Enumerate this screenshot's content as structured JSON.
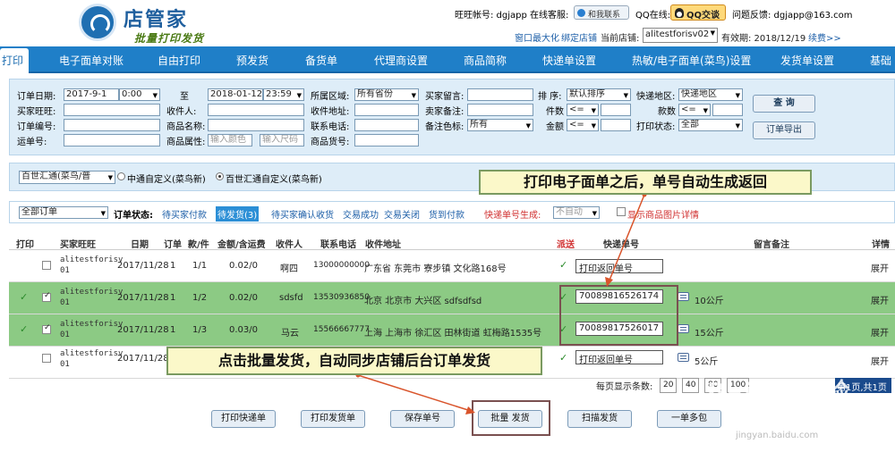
{
  "header": {
    "logo_title": "店管家",
    "logo_subtitle": "批量打印发货",
    "wangwang_label": "旺旺帐号: dgjapp 在线客服:",
    "cs_button": "和我联系",
    "qq_label": "QQ在线:",
    "qq_button": "QQ交谈",
    "feedback": "问题反馈: dgjapp@163.com",
    "window_max": "窗口最大化",
    "bind_shop": "绑定店铺",
    "current_shop_label": "当前店铺:",
    "current_shop": "alitestforisv02",
    "valid_until": "有效期: 2018/12/19",
    "renew": "续费>>"
  },
  "nav": {
    "tabs": [
      "打印",
      "电子面单对账",
      "自由打印",
      "预发货",
      "备货单",
      "代理商设置",
      "商品简称",
      "快递单设置",
      "热敏/电子面单(菜鸟)设置",
      "发货单设置",
      "基础"
    ]
  },
  "filter": {
    "order_date_label": "订单日期:",
    "date_from": "2017-9-1",
    "time_from": "0:00",
    "to_label": "至",
    "date_to": "2018-01-12",
    "time_to": "23:59",
    "region_label": "所属区域:",
    "region_value": "所有省份",
    "buyer_msg_label": "买家留言:",
    "sort_label": "排 序:",
    "sort_value": "默认排序",
    "express_region_label": "快递地区:",
    "express_region_value": "快递地区",
    "buyer_ww_label": "买家旺旺:",
    "receiver_label": "收件人:",
    "address_label": "收件地址:",
    "seller_note_label": "卖家备注:",
    "item_count_label": "件数",
    "item_count_op": "<=",
    "kinds_label": "款数",
    "kinds_op": "<=",
    "order_no_label": "订单编号:",
    "goods_name_label": "商品名称:",
    "phone_label": "联系电话:",
    "note_color_label": "备注色标:",
    "note_color_value": "所有",
    "amount_label": "金额",
    "amount_op": "<=",
    "print_status_label": "打印状态:",
    "print_status_value": "全部",
    "waybill_label": "运单号:",
    "goods_attr_label": "商品属性:",
    "color_placeholder": "输入颜色",
    "size_placeholder": "输入尺码",
    "goods_code_label": "商品货号:",
    "query_button": "查 询",
    "export_button": "订单导出"
  },
  "template_bar": {
    "select_value": "百世汇通(菜鸟/普",
    "radio1": "中通自定义(菜鸟新)",
    "radio2": "百世汇通自定义(菜鸟新)"
  },
  "status_bar": {
    "order_filter": "全部订单",
    "status_label": "订单状态:",
    "statuses": [
      "待买家付款",
      "待发货",
      "待买家确认收货",
      "交易成功",
      "交易关闭",
      "货到付款"
    ],
    "pending_count": "(3)",
    "express_gen_label": "快递单号生成:",
    "express_gen_value": "不自动",
    "show_images": "显示商品图片详情"
  },
  "table": {
    "headers": [
      "打印",
      "买家旺旺",
      "日期",
      "订单",
      "款/件",
      "金额/含运费",
      "收件人",
      "联系电话",
      "收件地址",
      "派送",
      "快递单号",
      "留言备注",
      "详情"
    ],
    "rows": [
      {
        "buyer": "alitestforisv01",
        "date": "2017/11/28",
        "order": "1",
        "qty": "1/1",
        "amount": "0.02/0",
        "receiver": "啊四",
        "phone": "13000000000",
        "address": "广东省 东莞市 寮步镇 文化路168号",
        "tracking": "打印返回单号",
        "weight": "",
        "detail": "展开"
      },
      {
        "buyer": "alitestforisv01",
        "date": "2017/11/28",
        "order": "1",
        "qty": "1/2",
        "amount": "0.02/0",
        "receiver": "sdsfd",
        "phone": "13530936850",
        "address": "北京 北京市 大兴区 sdfsdfsd",
        "tracking": "70089816526174",
        "weight": "10公斤",
        "detail": "展开"
      },
      {
        "buyer": "alitestforisv01",
        "date": "2017/11/28",
        "order": "1",
        "qty": "1/3",
        "amount": "0.03/0",
        "receiver": "马云",
        "phone": "15566667777",
        "address": "上海 上海市 徐汇区 田林街道 虹梅路1535号",
        "tracking": "70089817526017",
        "weight": "15公斤",
        "detail": "展开"
      },
      {
        "buyer": "alitestforisv01",
        "date": "2017/11/28",
        "order": "",
        "qty": "",
        "amount": "",
        "receiver": "",
        "phone": "",
        "address": "",
        "tracking": "打印返回单号",
        "weight": "5公斤",
        "detail": "展开"
      }
    ]
  },
  "pager": {
    "per_page_label": "每页显示条数:",
    "options": [
      "20",
      "40",
      "80",
      "100"
    ],
    "current": "第1页,共1页"
  },
  "actions": [
    "打印快递单",
    "打印发货单",
    "保存单号",
    "批量 发货",
    "扫描发货",
    "一单多包"
  ],
  "callouts": {
    "top": "打印电子面单之后，单号自动生成返回",
    "bottom": "点击批量发货，自动同步店铺后台订单发货"
  },
  "watermark": {
    "big": "Baidu 经验",
    "small": "jingyan.baidu.com"
  },
  "colors": {
    "nav_blue": "#1f7fc8",
    "row_green": "#8cca84",
    "callout_bg": "#fbf8c9",
    "arrow": "#d9542b"
  }
}
